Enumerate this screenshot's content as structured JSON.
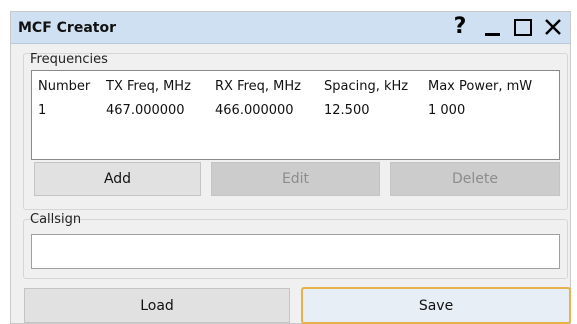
{
  "window": {
    "title": "MCF Creator"
  },
  "titlebar_buttons": {
    "help": "?",
    "close": "✕"
  },
  "frequencies": {
    "group_label": "Frequencies",
    "columns": [
      "Number",
      "TX Freq, MHz",
      "RX Freq, MHz",
      "Spacing, kHz",
      "Max Power, mW"
    ],
    "rows": [
      [
        "1",
        "467.000000",
        "466.000000",
        "12.500",
        "1 000"
      ]
    ],
    "buttons": {
      "add": "Add",
      "edit": "Edit",
      "delete": "Delete"
    }
  },
  "callsign": {
    "group_label": "Callsign",
    "value": ""
  },
  "footer": {
    "load": "Load",
    "save": "Save"
  }
}
